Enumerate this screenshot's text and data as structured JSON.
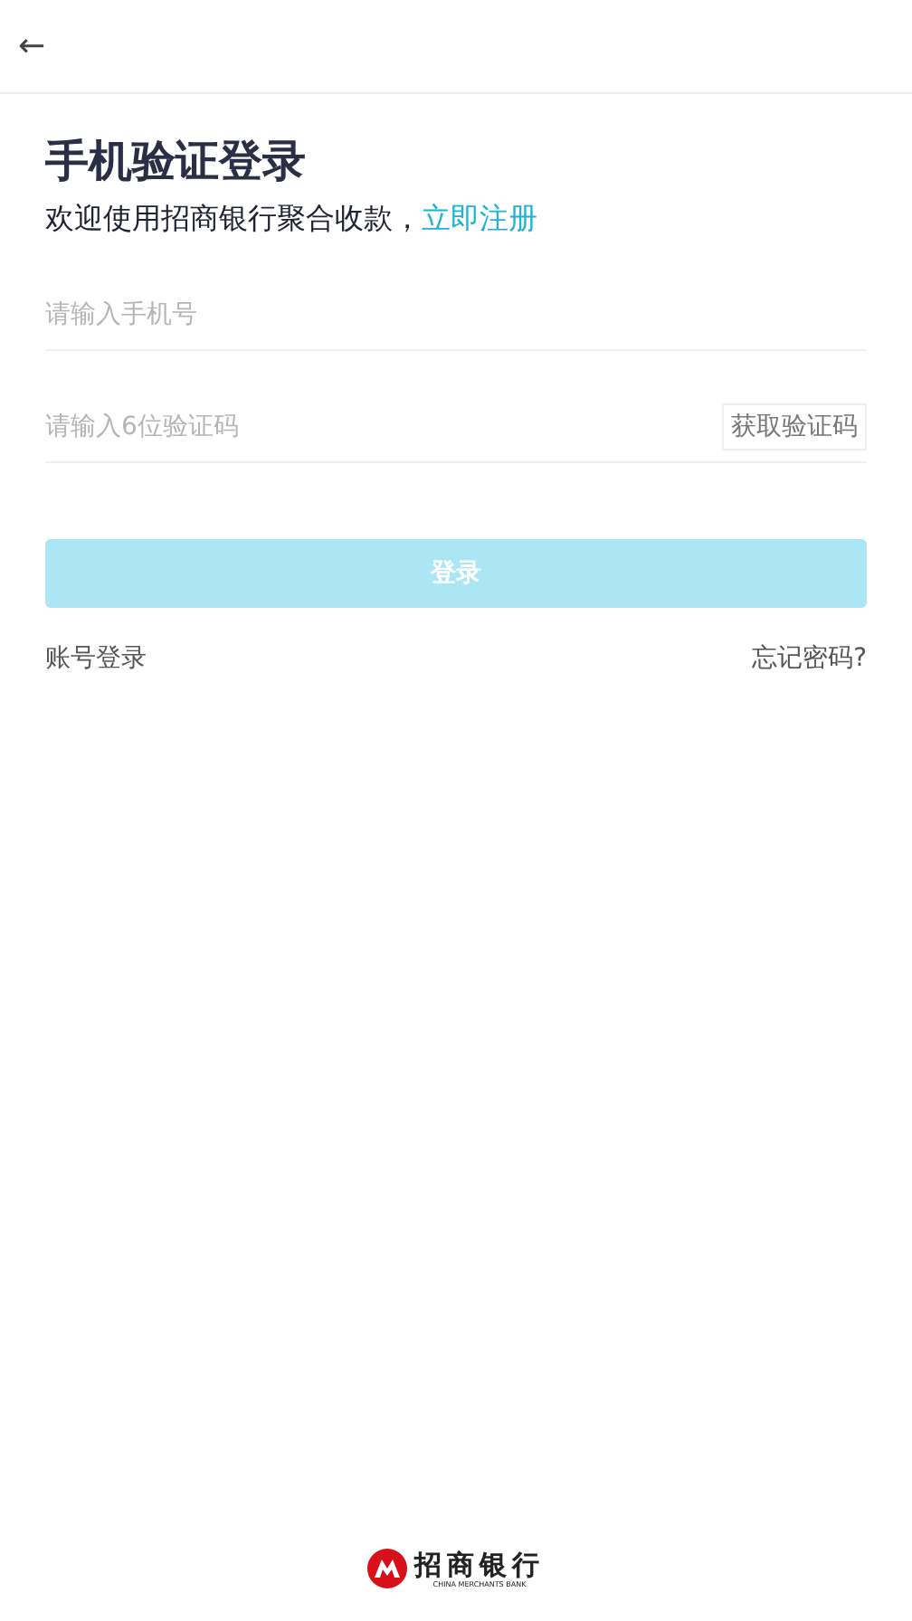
{
  "header": {
    "back_icon": "←"
  },
  "title": "手机验证登录",
  "subtitle": {
    "text": "欢迎使用招商银行聚合收款，",
    "link": "立即注册"
  },
  "fields": [
    {
      "placeholder": "请输入手机号"
    },
    {
      "placeholder": "请输入6位验证码",
      "action": "获取验证码"
    }
  ],
  "login_button": {
    "label": "登录",
    "disabled": true
  },
  "links": [
    "账号登录",
    "忘记密码?"
  ],
  "footer_logo": {
    "name": "招商银行",
    "english": "CHINA MERCHANTS BANK"
  }
}
